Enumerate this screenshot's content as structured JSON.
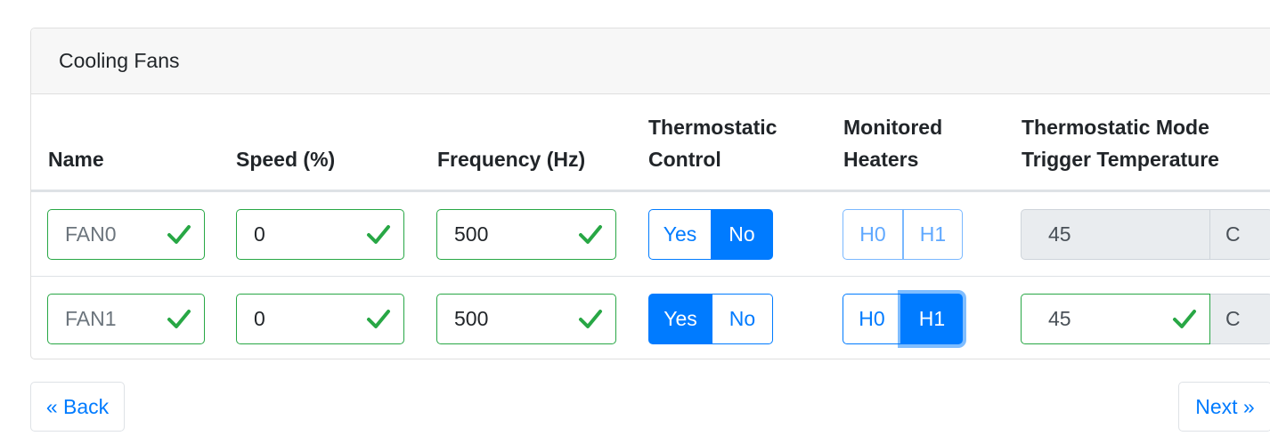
{
  "card": {
    "title": "Cooling Fans"
  },
  "table": {
    "headers": {
      "name": "Name",
      "speed": "Speed (%)",
      "frequency": "Frequency (Hz)",
      "thermostatic_line1": "Thermostatic",
      "thermostatic_line2": "Control",
      "monitored_line1": "Monitored",
      "monitored_line2": "Heaters",
      "trigger_line1": "Thermostatic Mode",
      "trigger_line2": "Trigger Temperature"
    },
    "rows": [
      {
        "name": "FAN0",
        "speed": "0",
        "frequency": "500",
        "thermostatic_yes": "Yes",
        "thermostatic_no": "No",
        "thermostatic_selected": "No",
        "heater_h0": "H0",
        "heater_h1": "H1",
        "heaters_enabled": false,
        "trigger_temperature": "45",
        "trigger_enabled": false,
        "unit": "C"
      },
      {
        "name": "FAN1",
        "speed": "0",
        "frequency": "500",
        "thermostatic_yes": "Yes",
        "thermostatic_no": "No",
        "thermostatic_selected": "Yes",
        "heater_h0": "H0",
        "heater_h1": "H1",
        "heaters_selected": [
          "H1"
        ],
        "heaters_enabled": true,
        "trigger_temperature": "45",
        "trigger_enabled": true,
        "unit": "C"
      }
    ]
  },
  "nav": {
    "back_label": "« Back",
    "next_label": "Next »"
  },
  "colors": {
    "primary": "#007bff",
    "valid": "#28a745",
    "header_bg": "#f7f7f7"
  }
}
